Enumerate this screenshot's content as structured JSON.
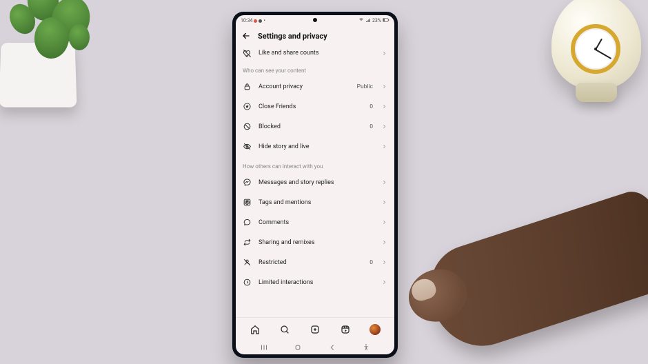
{
  "status": {
    "time": "10:34",
    "battery": "23%"
  },
  "header": {
    "title": "Settings and privacy"
  },
  "scrolled_row": {
    "label": "Like and share counts"
  },
  "sections": [
    {
      "title": "Who can see your content",
      "items": [
        {
          "icon": "lock",
          "name": "account-privacy",
          "label": "Account privacy",
          "value": "Public"
        },
        {
          "icon": "star",
          "name": "close-friends",
          "label": "Close Friends",
          "value": "0"
        },
        {
          "icon": "blocked",
          "name": "blocked",
          "label": "Blocked",
          "value": "0"
        },
        {
          "icon": "hide",
          "name": "hide-story-live",
          "label": "Hide story and live"
        }
      ]
    },
    {
      "title": "How others can interact with you",
      "items": [
        {
          "icon": "message",
          "name": "messages-replies",
          "label": "Messages and story replies"
        },
        {
          "icon": "at",
          "name": "tags-mentions",
          "label": "Tags and mentions"
        },
        {
          "icon": "comment",
          "name": "comments",
          "label": "Comments"
        },
        {
          "icon": "remix",
          "name": "sharing-remixes",
          "label": "Sharing and remixes"
        },
        {
          "icon": "restrict",
          "name": "restricted",
          "label": "Restricted",
          "value": "0"
        },
        {
          "icon": "limited",
          "name": "limited-interactions",
          "label": "Limited interactions"
        }
      ]
    }
  ]
}
